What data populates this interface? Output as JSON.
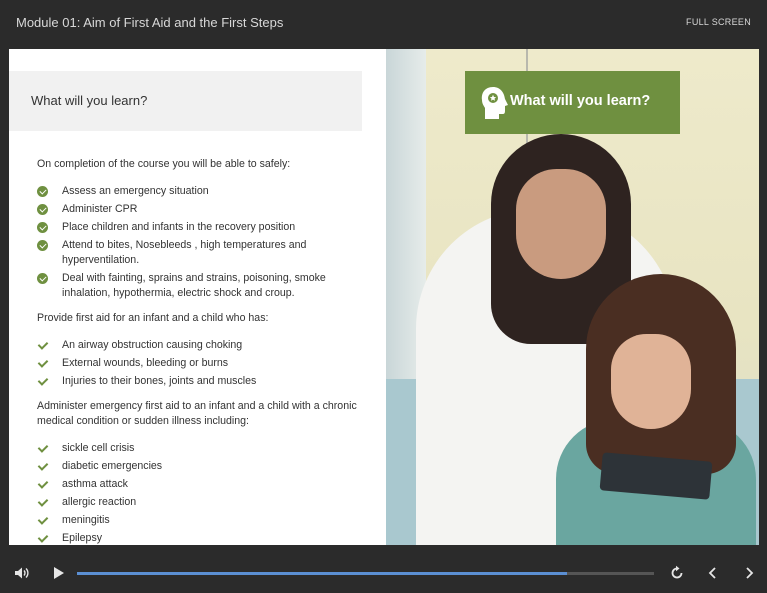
{
  "header": {
    "title": "Module 01: Aim of First Aid and the First Steps",
    "fullscreen_label": "FULL SCREEN"
  },
  "slide": {
    "heading": "What will you learn?",
    "badge_text": "What will you learn?",
    "intro": "On completion of the course you will be able to safely:",
    "list1": [
      "Assess an emergency situation",
      "Administer CPR",
      "Place children and infants in the recovery position",
      "Attend to bites, Nosebleeds , high temperatures and hyperventilation.",
      "Deal with fainting, sprains and strains, poisoning, smoke inhalation, hypothermia, electric shock and croup."
    ],
    "para2": "Provide first aid for an infant and a child who has:",
    "list2": [
      "An airway obstruction causing choking",
      "External wounds, bleeding or burns",
      "Injuries to their bones, joints and muscles"
    ],
    "para3": "Administer emergency first aid to an infant and a child with a chronic medical condition or sudden illness including:",
    "list3": [
      "sickle cell crisis",
      "diabetic emergencies",
      "asthma attack",
      "allergic reaction",
      "meningitis",
      "Epilepsy"
    ]
  },
  "player": {
    "progress_fraction": 0.85,
    "icons": [
      "volume-icon",
      "play-icon",
      "replay-icon",
      "chevron-left-icon",
      "chevron-right-icon"
    ]
  },
  "colors": {
    "accent_green": "#6f9040",
    "progress_blue": "#5b8fd3",
    "chrome_dark": "#2b2b2b"
  }
}
